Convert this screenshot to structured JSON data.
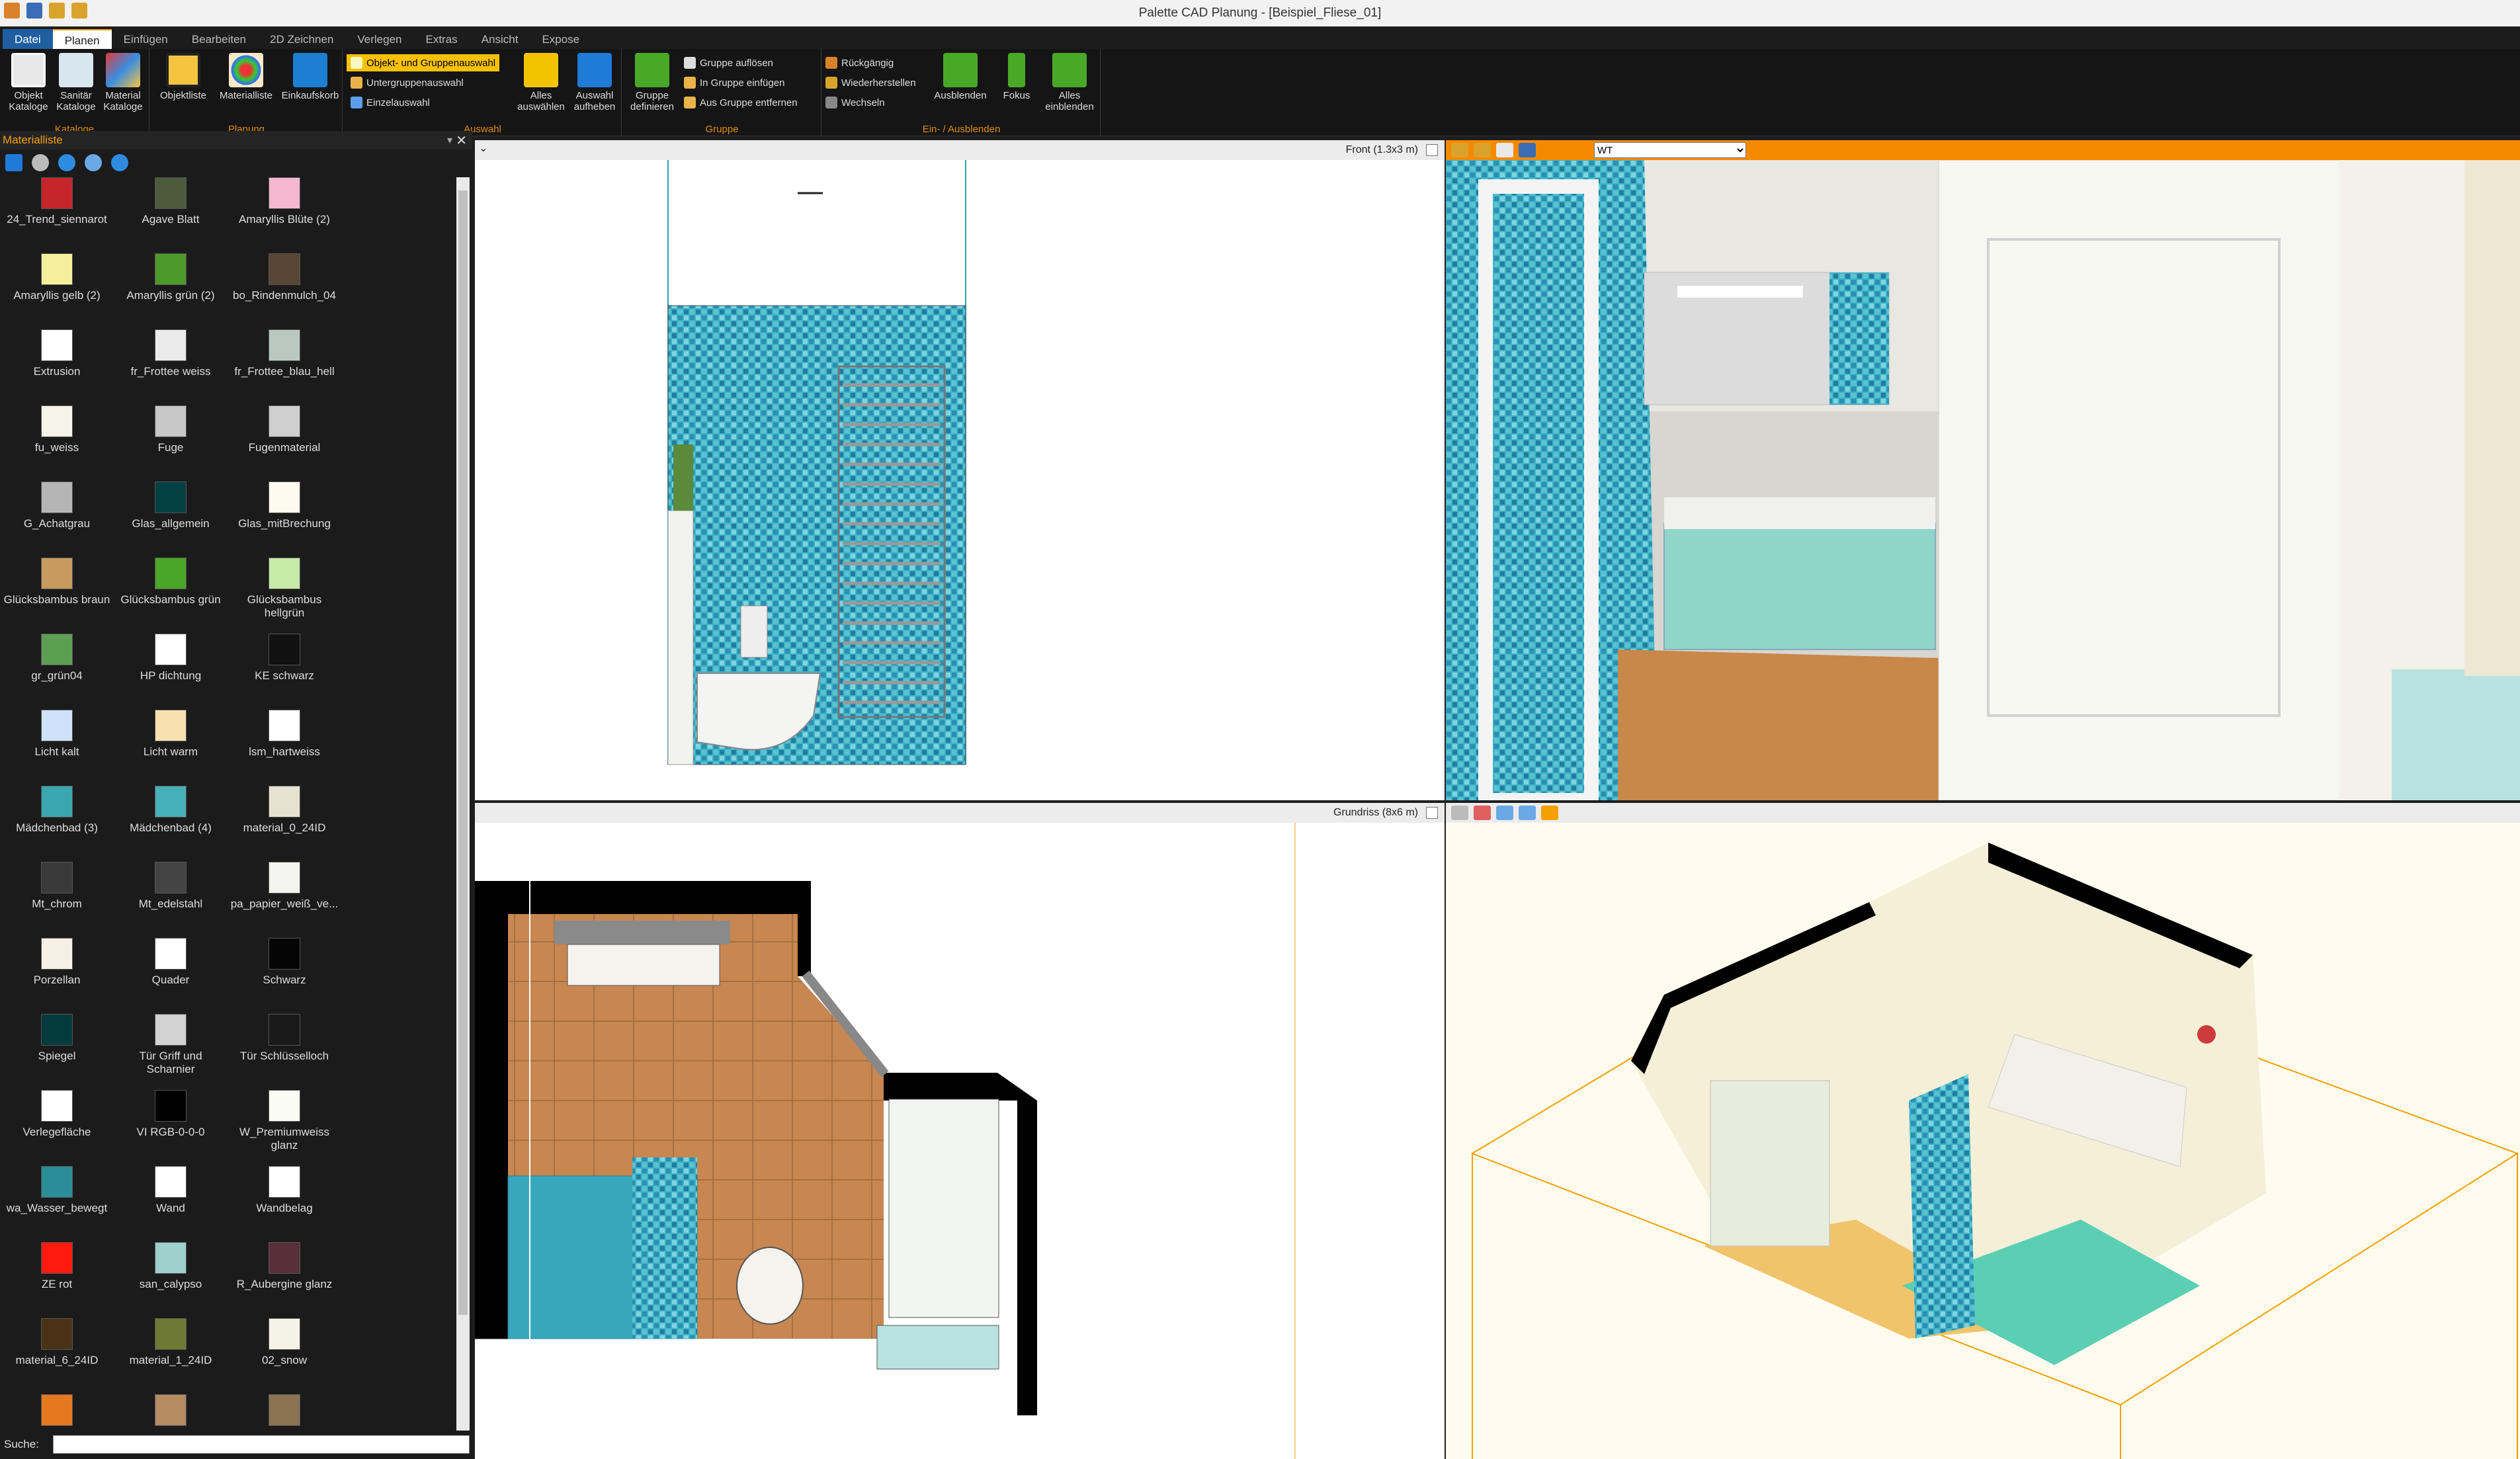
{
  "window": {
    "title": "Palette CAD Planung - [Beispiel_Fliese_01]"
  },
  "menu": [
    "Datei",
    "Planen",
    "Einfügen",
    "Bearbeiten",
    "2D Zeichnen",
    "Verlegen",
    "Extras",
    "Ansicht",
    "Expose"
  ],
  "ribbon": {
    "kataloge": {
      "label": "Kataloge",
      "buttons": [
        "Objekt\nKataloge",
        "Sanitär\nKataloge",
        "Material\nKataloge"
      ]
    },
    "planung": {
      "label": "Planung",
      "buttons": [
        "Objektliste",
        "Materialliste",
        "Einkaufskorb"
      ]
    },
    "auswahl": {
      "label": "Auswahl",
      "small": [
        "Objekt- und Gruppenauswahl",
        "Untergruppenauswahl",
        "Einzelauswahl"
      ],
      "big": [
        "Alles\nauswählen",
        "Auswahl\naufheben"
      ]
    },
    "gruppe": {
      "label": "Gruppe",
      "big": "Gruppe\ndefinieren",
      "small": [
        "Gruppe auflösen",
        "In Gruppe einfügen",
        "Aus Gruppe entfernen"
      ]
    },
    "einausblenden": {
      "label": "Ein- / Ausblenden",
      "small": [
        "Rückgängig",
        "Wiederherstellen",
        "Wechseln"
      ],
      "big": [
        "Ausblenden",
        "Fokus",
        "Alles\neinblenden"
      ]
    }
  },
  "panel": {
    "title": "Materialliste",
    "search_label": "Suche:",
    "materials": [
      {
        "name": "24_Trend_siennarot",
        "color": "#c4262a"
      },
      {
        "name": "Agave Blatt",
        "color": "#4d5a3c"
      },
      {
        "name": "Amaryllis Blüte (2)",
        "color": "#f5b8cf"
      },
      {
        "name": "Amaryllis gelb (2)",
        "color": "#f3ef9a"
      },
      {
        "name": "Amaryllis grün (2)",
        "color": "#4c9a2a"
      },
      {
        "name": "bo_Rindenmulch_04",
        "color": "#5a4634"
      },
      {
        "name": "Extrusion",
        "color": "#ffffff"
      },
      {
        "name": "fr_Frottee weiss",
        "color": "#ebebeb"
      },
      {
        "name": "fr_Frottee_blau_hell",
        "color": "#b9c9c2"
      },
      {
        "name": "fu_weiss",
        "color": "#f5f3ea"
      },
      {
        "name": "Fuge",
        "color": "#c8c8c8"
      },
      {
        "name": "Fugenmaterial",
        "color": "#cfcfcf"
      },
      {
        "name": "G_Achatgrau",
        "color": "#b5b5b5"
      },
      {
        "name": "Glas_allgemein",
        "color": "#034144"
      },
      {
        "name": "Glas_mitBrechung",
        "color": "#fdfbf0"
      },
      {
        "name": "Glücksbambus braun",
        "color": "#c89a5e"
      },
      {
        "name": "Glücksbambus grün",
        "color": "#4aa529"
      },
      {
        "name": "Glücksbambus hellgrün",
        "color": "#c6eaa8"
      },
      {
        "name": "gr_grün04",
        "color": "#5c9f52"
      },
      {
        "name": "HP dichtung",
        "color": "#ffffff"
      },
      {
        "name": "KE schwarz",
        "color": "#111111"
      },
      {
        "name": "Licht kalt",
        "color": "#cde2fa"
      },
      {
        "name": "Licht warm",
        "color": "#f8e0b0"
      },
      {
        "name": "lsm_hartweiss",
        "color": "#ffffff"
      },
      {
        "name": "Mädchenbad (3)",
        "color": "#3aa6b0"
      },
      {
        "name": "Mädchenbad (4)",
        "color": "#48b0b8"
      },
      {
        "name": "material_0_24ID",
        "color": "#e5e3cf"
      },
      {
        "name": "Mt_chrom",
        "color": "#3a3a3a"
      },
      {
        "name": "Mt_edelstahl",
        "color": "#444444"
      },
      {
        "name": "pa_papier_weiß_ve...",
        "color": "#f4f4f0"
      },
      {
        "name": "Porzellan",
        "color": "#f6f1e4"
      },
      {
        "name": "Quader",
        "color": "#ffffff"
      },
      {
        "name": "Schwarz",
        "color": "#050505"
      },
      {
        "name": "Spiegel",
        "color": "#053b3d"
      },
      {
        "name": "Tür Griff und Scharnier",
        "color": "#d2d2d2"
      },
      {
        "name": "Tür Schlüsselloch",
        "color": "#1a1a1a"
      },
      {
        "name": "Verlegefläche",
        "color": "#ffffff"
      },
      {
        "name": "VI RGB-0-0-0",
        "color": "#000000"
      },
      {
        "name": "W_Premiumweiss glanz",
        "color": "#fbfbf6"
      },
      {
        "name": "wa_Wasser_bewegt",
        "color": "#2a8d98"
      },
      {
        "name": "Wand",
        "color": "#ffffff"
      },
      {
        "name": "Wandbelag",
        "color": "#ffffff"
      },
      {
        "name": "ZE rot",
        "color": "#ff1a0f"
      },
      {
        "name": "san_calypso",
        "color": "#9fcfcc"
      },
      {
        "name": "R_Aubergine glanz",
        "color": "#5a2f3c"
      },
      {
        "name": "material_6_24ID",
        "color": "#4a3217"
      },
      {
        "name": "material_1_24ID",
        "color": "#6e7a33"
      },
      {
        "name": "02_snow",
        "color": "#f5f3e8"
      },
      {
        "name": "",
        "color": "#e5791f"
      },
      {
        "name": "",
        "color": "#b68a63"
      },
      {
        "name": "",
        "color": "#8c7352"
      }
    ]
  },
  "viewports": {
    "front": {
      "label": "Front  (1.3x3 m)"
    },
    "render": {
      "dropdown": "WT"
    },
    "grundriss": {
      "label": "Grundriss  (8x6 m)"
    }
  },
  "colors": {
    "accent": "#f58a00",
    "tile_blue": "#2fa9bd",
    "floor_brown": "#c88650"
  }
}
